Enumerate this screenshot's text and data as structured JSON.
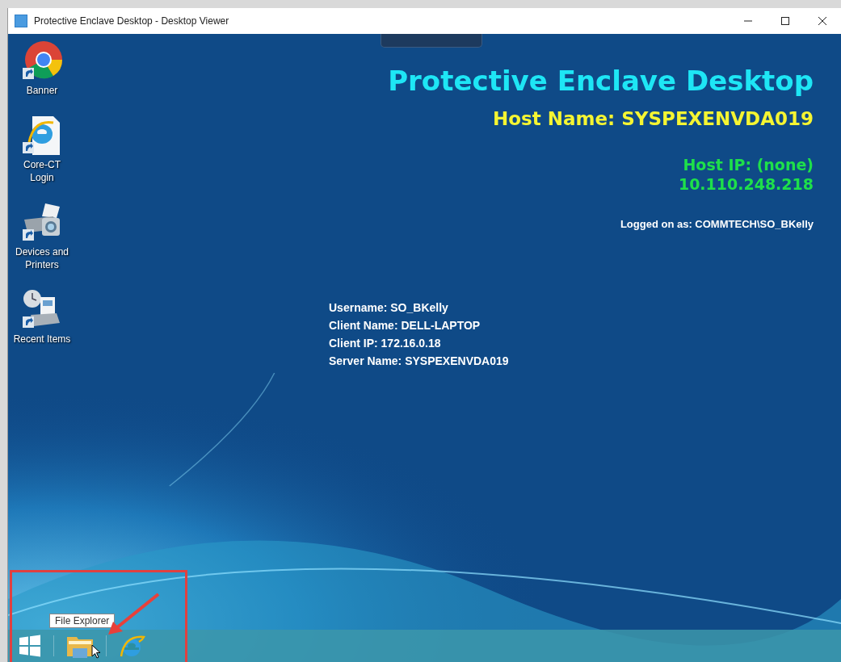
{
  "window": {
    "title": "Protective Enclave Desktop - Desktop Viewer"
  },
  "desktop_icons": [
    {
      "kind": "chrome",
      "label": "Banner"
    },
    {
      "kind": "ie-doc",
      "label": "Core-CT Login"
    },
    {
      "kind": "printer",
      "label": "Devices and Printers"
    },
    {
      "kind": "recent",
      "label": "Recent Items"
    }
  ],
  "banner": {
    "title": "Protective Enclave Desktop",
    "host_name": "Host Name: SYSPEXENVDA019",
    "host_ip": "Host IP: (none)",
    "ip": "10.110.248.218",
    "logged_on": "Logged on as: COMMTECH\\SO_BKelly"
  },
  "client_info": [
    "Username: SO_BKelly",
    "Client Name: DELL-LAPTOP",
    "Client IP: 172.16.0.18",
    "Server Name: SYSPEXENVDA019"
  ],
  "taskbar": {
    "items": [
      {
        "kind": "start"
      },
      {
        "kind": "folder"
      },
      {
        "kind": "ie"
      }
    ],
    "tooltip": "File Explorer"
  }
}
